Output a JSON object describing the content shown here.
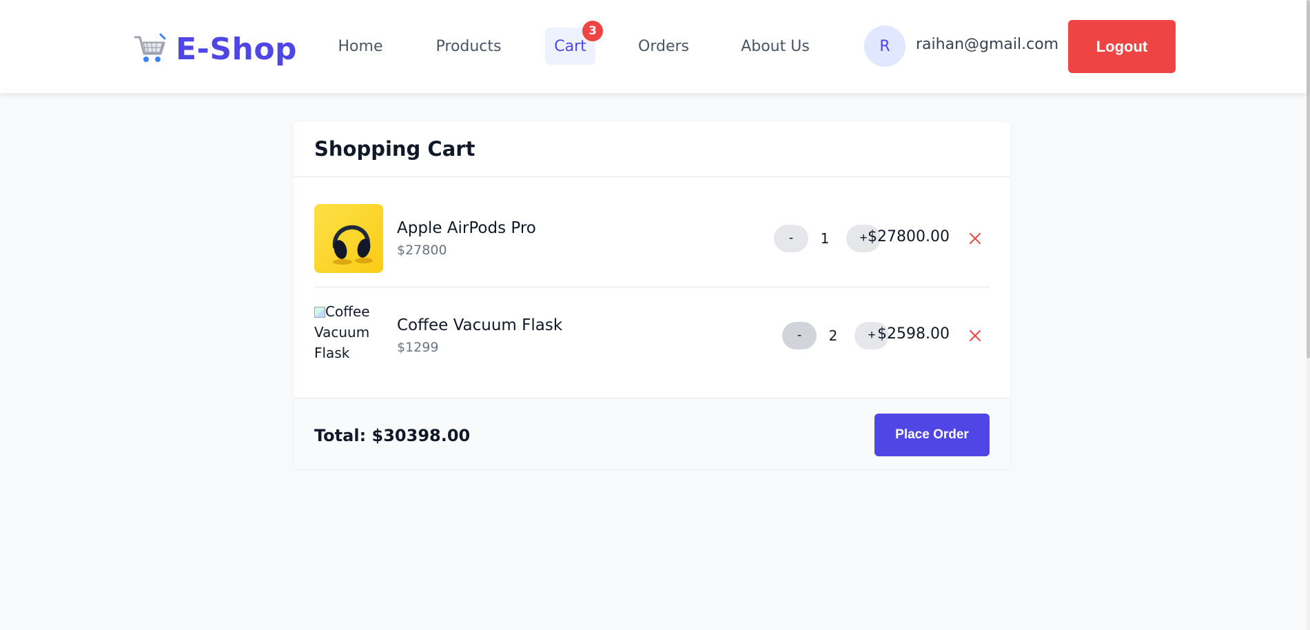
{
  "header": {
    "brand_name": "E-Shop",
    "brand_icon": "shopping-cart-icon",
    "nav": [
      {
        "label": "Home"
      },
      {
        "label": "Products"
      },
      {
        "label": "Cart",
        "badge": "3",
        "active": true
      },
      {
        "label": "Orders"
      },
      {
        "label": "About Us"
      }
    ],
    "user": {
      "avatar_initial": "R",
      "email": "raihan@gmail.com"
    },
    "logout_label": "Logout"
  },
  "cart": {
    "title": "Shopping Cart",
    "items": [
      {
        "name": "Apple AirPods Pro",
        "unit_price": "$27800",
        "quantity": "1",
        "line_total": "$27800.00",
        "image_alt": "Apple AirPods Pro",
        "minus_label": "-",
        "plus_label": "+"
      },
      {
        "name": "Coffee Vacuum Flask",
        "unit_price": "$1299",
        "quantity": "2",
        "line_total": "$2598.00",
        "image_alt": "Coffee Vacuum Flask",
        "minus_label": "-",
        "plus_label": "+"
      }
    ],
    "total_label": "Total: $30398.00",
    "place_order_label": "Place Order"
  },
  "colors": {
    "primary": "#4f46e5",
    "danger": "#ef4444",
    "background": "#f8f9fa"
  }
}
